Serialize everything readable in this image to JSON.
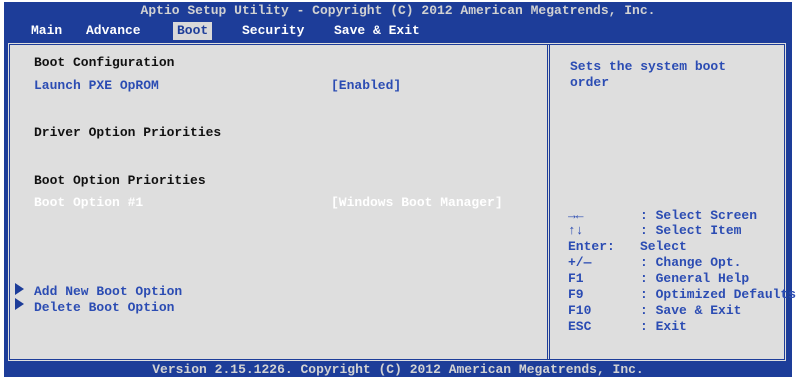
{
  "title": "Aptio Setup Utility - Copyright (C) 2012 American Megatrends, Inc.",
  "menu": [
    "Main",
    "Advance",
    "Boot",
    "Security",
    "Save & Exit"
  ],
  "active_menu": "Boot",
  "main": {
    "boot_configuration": "Boot Configuration",
    "launch_pxe_label": "Launch PXE OpROM",
    "launch_pxe_value": "[Enabled]",
    "driver_option_priorities": "Driver Option Priorities",
    "boot_option_priorities": "Boot Option Priorities",
    "boot_option_1_label": "Boot Option #1",
    "boot_option_1_value": "[Windows Boot Manager]",
    "add_new_boot_option": "Add New Boot Option",
    "delete_boot_option": "Delete Boot Option"
  },
  "help": {
    "description": "Sets the system boot\norder",
    "keys": [
      {
        "key": "→←",
        "desc": ": Select Screen"
      },
      {
        "key": "↑↓",
        "desc": ": Select Item"
      },
      {
        "key": "Enter:",
        "desc": "Select"
      },
      {
        "key": "+/—",
        "desc": ": Change Opt."
      },
      {
        "key": "F1",
        "desc": ": General Help"
      },
      {
        "key": "F9",
        "desc": ": Optimized Defaults"
      },
      {
        "key": "F10",
        "desc": ": Save & Exit"
      },
      {
        "key": "ESC",
        "desc": ": Exit"
      }
    ]
  },
  "footer": "Version 2.15.1226. Copyright (C) 2012 American Megatrends, Inc."
}
